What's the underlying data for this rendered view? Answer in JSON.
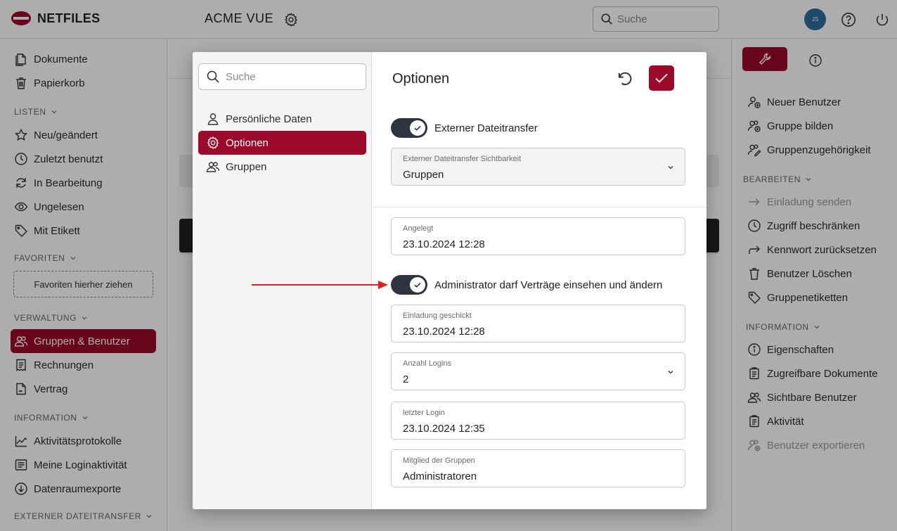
{
  "brand": {
    "name": "NETFILES",
    "color": "#9b0a2a"
  },
  "header": {
    "app_title": "ACME VUE",
    "search_placeholder": "Suche",
    "avatar_initials": "JS"
  },
  "sidebar": {
    "items_top": [
      {
        "label": "Dokumente",
        "icon": "document-icon"
      },
      {
        "label": "Papierkorb",
        "icon": "trash-icon"
      }
    ],
    "sections": {
      "listen": "LISTEN",
      "favoriten": "FAVORITEN",
      "verwaltung": "VERWALTUNG",
      "information": "INFORMATION",
      "externer": "EXTERNER DATEITRANSFER"
    },
    "listen_items": [
      {
        "label": "Neu/geändert"
      },
      {
        "label": "Zuletzt benutzt"
      },
      {
        "label": "In Bearbeitung"
      },
      {
        "label": "Ungelesen"
      },
      {
        "label": "Mit Etikett"
      }
    ],
    "favorites_drop": "Favoriten hierher ziehen",
    "verwaltung_items": [
      {
        "label": "Gruppen & Benutzer",
        "active": true
      },
      {
        "label": "Rechnungen"
      },
      {
        "label": "Vertrag"
      }
    ],
    "information_items": [
      {
        "label": "Aktivitätsprotokolle"
      },
      {
        "label": "Meine Loginaktivität"
      },
      {
        "label": "Datenraumexporte"
      }
    ]
  },
  "right_panel": {
    "actions": [
      {
        "label": "Neuer Benutzer"
      },
      {
        "label": "Gruppe bilden"
      },
      {
        "label": "Gruppenzugehörigkeit"
      }
    ],
    "bearbeiten_title": "BEARBEITEN",
    "bearbeiten": [
      {
        "label": "Einladung senden",
        "disabled": true
      },
      {
        "label": "Zugriff beschränken"
      },
      {
        "label": "Kennwort zurücksetzen"
      },
      {
        "label": "Benutzer Löschen"
      },
      {
        "label": "Gruppenetiketten"
      }
    ],
    "information_title": "INFORMATION",
    "information": [
      {
        "label": "Eigenschaften"
      },
      {
        "label": "Zugreifbare Dokumente"
      },
      {
        "label": "Sichtbare Benutzer"
      },
      {
        "label": "Aktivität"
      },
      {
        "label": "Benutzer exportieren",
        "disabled": true
      }
    ]
  },
  "modal": {
    "search_placeholder": "Suche",
    "nav": [
      {
        "label": "Persönliche Daten",
        "icon": "person-icon"
      },
      {
        "label": "Optionen",
        "icon": "gear-icon",
        "active": true
      },
      {
        "label": "Gruppen",
        "icon": "people-icon"
      }
    ],
    "title": "Optionen",
    "toggle_external": {
      "label": "Externer Dateitransfer",
      "on": true
    },
    "visibility_field": {
      "label": "Externer Dateitransfer Sichtbarkeit",
      "value": "Gruppen"
    },
    "created_field": {
      "label": "Angelegt",
      "value": "23.10.2024 12:28"
    },
    "toggle_admin": {
      "label": "Administrator darf Verträge einsehen und ändern",
      "on": true
    },
    "invite_field": {
      "label": "Einladung geschickt",
      "value": "23.10.2024 12:28"
    },
    "logins_field": {
      "label": "Anzahl Logins",
      "value": "2"
    },
    "last_login_field": {
      "label": "letzter Login",
      "value": "23.10.2024 12:35"
    },
    "groups_field": {
      "label": "Mitglied der Gruppen",
      "value": "Administratoren"
    }
  }
}
